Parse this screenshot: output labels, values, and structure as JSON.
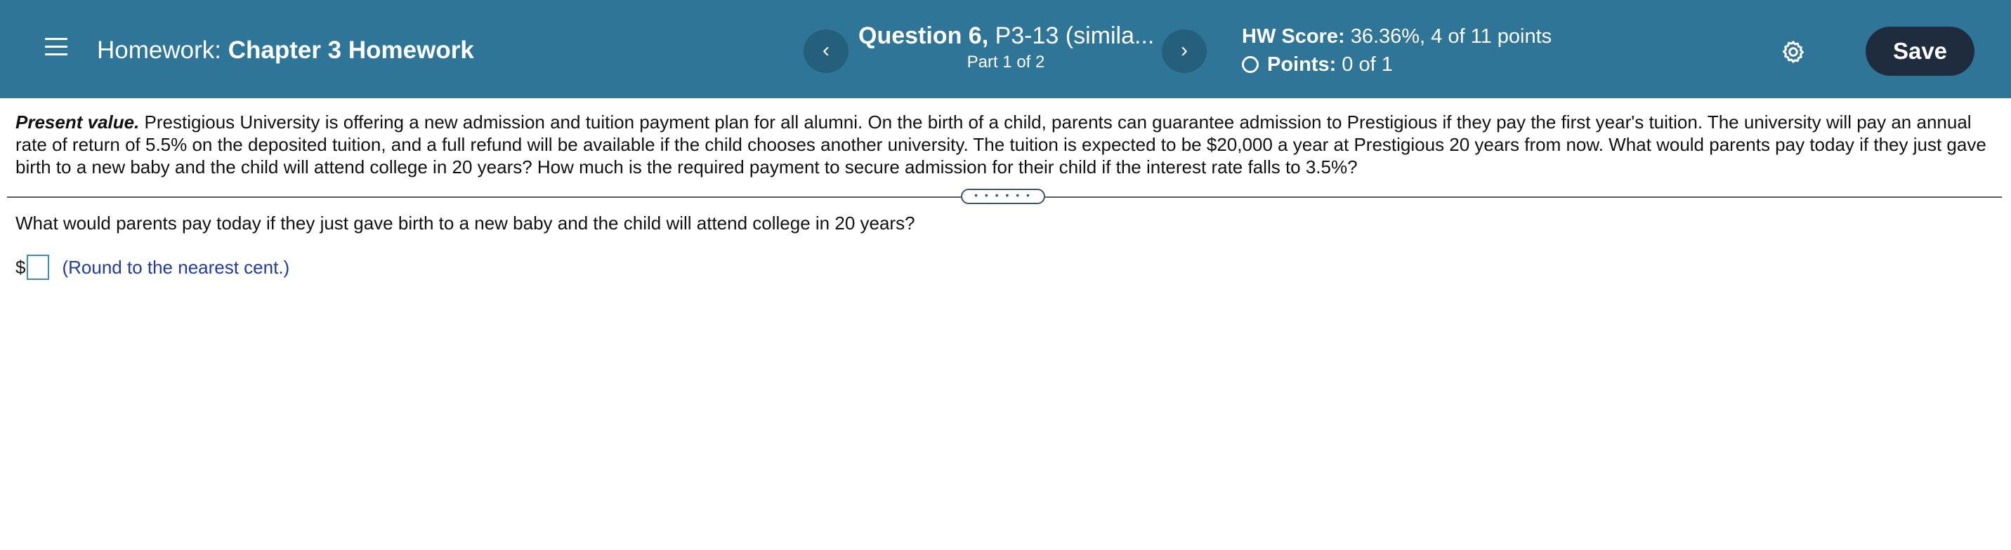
{
  "header": {
    "menu_icon": "hamburger-menu-icon",
    "homework_prefix": "Homework:",
    "homework_name": "Chapter 3 Homework",
    "prev_label": "‹",
    "next_label": "›",
    "question_number": "Question 6,",
    "question_name": " P3-13 (simila...",
    "part_text": "Part 1 of 2",
    "hw_score_label": "HW Score:",
    "hw_score_value": "36.36%, 4 of 11 points",
    "points_label": "Points:",
    "points_value": "0 of 1",
    "settings_icon": "gear-icon",
    "save_label": "Save"
  },
  "problem": {
    "intro": "Present value.",
    "text": "  Prestigious University is offering a new admission and tuition payment plan for all alumni.  On the birth of a child, parents can guarantee admission to Prestigious if they pay the first year's tuition.  The university will pay an annual rate of return of 5.5% on the deposited tuition, and a full refund will be available if the child chooses another university.  The tuition is expected to be $20,000 a year at Prestigious 20 years from now.  What would parents pay today if they just gave birth to a new baby and the child will attend college in 20 years?  How much is the required payment to secure admission for their child if the interest rate falls to 3.5%?"
  },
  "divider": {
    "handle_label": "• • • • • •"
  },
  "subquestion": {
    "text": "What would parents pay today if they just gave birth to a new baby and the child will attend college in 20 years?"
  },
  "answer": {
    "currency": "$",
    "value": "",
    "hint": "(Round to the nearest cent.)"
  },
  "colors": {
    "header_bg": "#2e7597",
    "nav_button_bg": "#245f7c",
    "save_button_bg": "#1f2c3d",
    "hint_text": "#1f3d99",
    "input_border": "#3c8dbc"
  }
}
